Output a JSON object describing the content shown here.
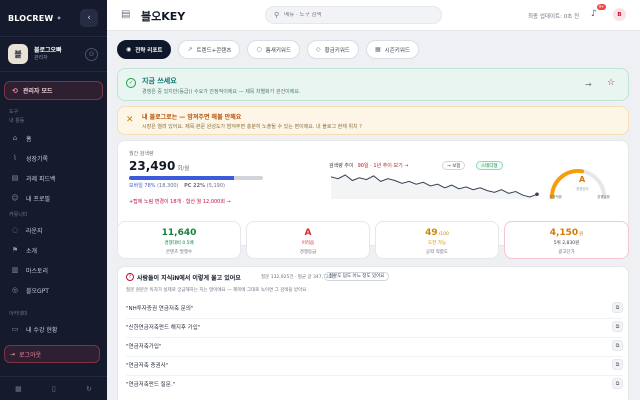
{
  "sidebar": {
    "logo": "BLOCREW",
    "logo_suffix": "•",
    "profile_name": "블로그오빠",
    "profile_role": "관리자",
    "avatar_letter": "블",
    "admin_mode": "관리자 모드",
    "section_tools": "도구",
    "section_my": "내 활동",
    "section_community": "커뮤니티",
    "section_learning": "아카데미",
    "items": [
      {
        "label": "홈",
        "icon": "home-icon"
      },
      {
        "label": "성장기록",
        "icon": "chart-icon"
      },
      {
        "label": "과제 피드백",
        "icon": "feedback-icon"
      },
      {
        "label": "내 프로필",
        "icon": "user-icon"
      },
      {
        "label": "라운지",
        "icon": "chat-icon"
      },
      {
        "label": "소개",
        "icon": "info-icon"
      },
      {
        "label": "마스토리",
        "icon": "book-icon"
      },
      {
        "label": "블오GPT",
        "icon": "bot-icon"
      },
      {
        "label": "내 수강 현황",
        "icon": "course-icon"
      }
    ],
    "logout": "로그아웃"
  },
  "topbar": {
    "brand": "블오KEY",
    "search_placeholder": "메뉴 · 도구 검색",
    "updated": "최종 업데이트: 0초 전",
    "notif_count": "9+",
    "avatar_letter": "B"
  },
  "tabs": [
    {
      "label": "전략 리포트",
      "icon": "target-icon",
      "active": true
    },
    {
      "label": "트렌드+콘텐츠",
      "icon": "trend-icon",
      "active": false
    },
    {
      "label": "틈새키워드",
      "icon": "circle-icon",
      "active": false
    },
    {
      "label": "황금키워드",
      "icon": "diamond-icon",
      "active": false
    },
    {
      "label": "시즌키워드",
      "icon": "calendar-icon",
      "active": false
    }
  ],
  "alert_green": {
    "title": "지금 쓰세요",
    "sub": "경쟁은 중 있지만(등급)) 수요가 안정적이에요 — 제목 차별화가 관건이에요."
  },
  "alert_amber": {
    "title": "내 블로그로는 — 밤져주면 해볼 만해요",
    "sub": "시장은 열려 있어요. 제목·본문 완성도가 밤져주면 충분히 노출될 수 있는 편이에요. 내 블로그 현재 위치 ?"
  },
  "stats": {
    "label": "월간 검색량",
    "value": "23,490",
    "unit": "회/월",
    "mobile_ratio": 0.78,
    "mobile_label": "모바일 78%",
    "mobile_count": "(18,300)",
    "pc_label": "PC 22%",
    "pc_count": "(5,190)",
    "note": "+탑에 노림 변경이 18개 · 합산 월 12,000회 →",
    "trend_label": "검색량 추이",
    "trend_range": "90일 · 1년 추이 보기 →",
    "pill_view": "→ 보합",
    "pill_season": "스테디형",
    "gauge_grade": "A",
    "gauge_sub": "경쟁강도",
    "gauge_low": "경쟁적음",
    "gauge_high": "경쟁많음"
  },
  "trend_values": [
    62,
    60,
    64,
    58,
    61,
    59,
    63,
    57,
    60,
    58,
    55,
    57,
    54,
    56,
    52,
    54,
    50,
    53,
    49,
    51,
    48,
    50,
    47,
    45,
    48,
    44,
    46,
    42,
    40,
    43
  ],
  "gauge_level": 0.55,
  "metrics": [
    {
      "value": "11,640",
      "sub": "경쟁대비 0.5배",
      "label": "콘텐츠 발행수",
      "color": "#15803d"
    },
    {
      "value": "A",
      "sub": "어려움",
      "label": "경쟁등급",
      "color": "#dc2626"
    },
    {
      "value": "49",
      "value_suffix": "/100",
      "sub": "도전 가능",
      "label": "공략 적합도",
      "color": "#ca8a04"
    },
    {
      "value": "4,150",
      "value_suffix": "원",
      "sub": "5위 2,830원",
      "label": "광고단가",
      "color": "#d97706"
    }
  ],
  "questions": {
    "title": "사람들이 지식iN에서 이렇게 물고 있어요",
    "meta": "질문 132,925건 · 평균 글 347,732건",
    "toggle": "질문도 답도 어느 정도 있어요",
    "desc": "질문 원문은 독자가 실제로 궁금해하는 지는 말이에요 — 제목에 그대로 녹이면 그 검색을 받아요.",
    "items": [
      "\"NH투자증권 연금저축 문의\"",
      "\"신한연금저축펀드 해지후 가입\"",
      "\"연금저축가입\"",
      "\"연금저축 증권사\"",
      "\"연금저축펀드 질문.\""
    ]
  }
}
